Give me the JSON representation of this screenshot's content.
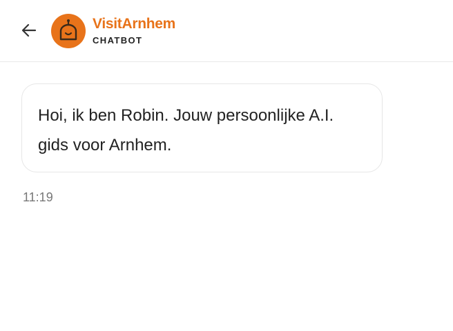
{
  "colors": {
    "accent": "#e8731a",
    "text": "#222222",
    "muted": "#777777",
    "border": "#e6e6e6"
  },
  "header": {
    "back_icon": "arrow-left-icon",
    "avatar_icon": "robot-face-icon",
    "title": "VisitArnhem",
    "subtitle": "CHATBOT"
  },
  "messages": [
    {
      "sender": "bot",
      "text": "Hoi, ik ben Robin. Jouw persoonlijke A.I. gids voor Arnhem.",
      "time": "11:19"
    }
  ]
}
